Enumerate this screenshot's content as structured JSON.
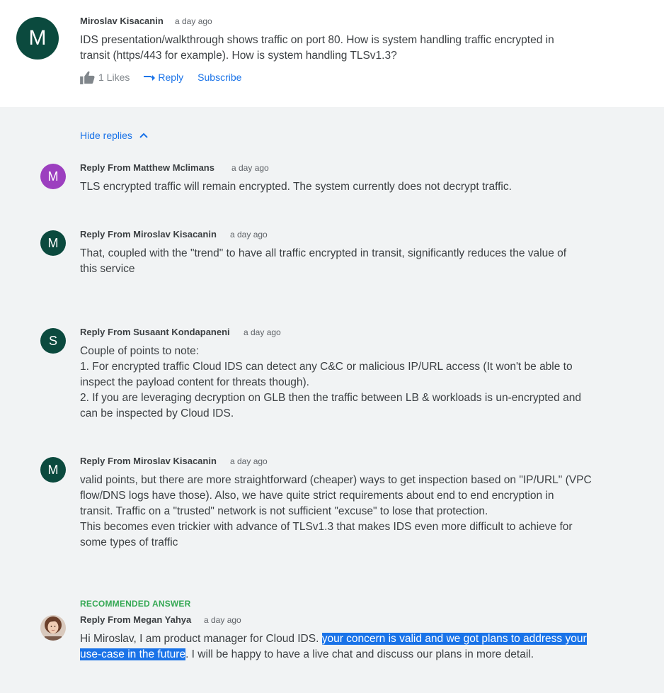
{
  "main_comment": {
    "avatar_letter": "M",
    "avatar_color": "#0b4a3e",
    "author": "Miroslav Kisacanin",
    "timestamp": "a day ago",
    "text_lines": [
      "IDS presentation/walkthrough shows traffic on port 80. How is system handling traffic encrypted in",
      "transit (https/443 for example). How is system handling TLSv1.3?"
    ],
    "likes_label": "1 Likes",
    "reply_label": "Reply",
    "subscribe_label": "Subscribe",
    "icons": [
      "thumbs-up-icon",
      "reply-arrow-icon"
    ]
  },
  "hide_replies_label": "Hide replies",
  "replies": [
    {
      "avatar_letter": "M",
      "avatar_color": "#9c3fbf",
      "author": "Reply From Matthew Mclimans",
      "timestamp": "a day ago",
      "text_lines": [
        "TLS encrypted traffic will remain encrypted.  The system currently does not decrypt traffic."
      ]
    },
    {
      "avatar_letter": "M",
      "avatar_color": "#0b4a3e",
      "author": "Reply From Miroslav Kisacanin",
      "timestamp": "a day ago",
      "text_lines": [
        "That, coupled with the \"trend\" to have all traffic encrypted in transit, significantly reduces the value of",
        "this service"
      ]
    },
    {
      "avatar_letter": "S",
      "avatar_color": "#0b4a3e",
      "author": "Reply From Susaant Kondapaneni",
      "timestamp": "a day ago",
      "text_lines": [
        "Couple of points to note:",
        "1. For encrypted traffic Cloud IDS can detect any C&C or malicious IP/URL access (It won't be able to",
        "inspect the payload content for threats though).",
        "2. If you are leveraging decryption on GLB  then the traffic between LB & workloads is un-encrypted and",
        "can be inspected by Cloud IDS."
      ]
    },
    {
      "avatar_letter": "M",
      "avatar_color": "#0b4a3e",
      "author": "Reply From Miroslav Kisacanin",
      "timestamp": "a day ago",
      "text_lines": [
        "valid points, but there are more straightforward (cheaper) ways to get inspection based on \"IP/URL\" (VPC",
        "flow/DNS logs have those). Also, we have quite strict requirements about end to end encryption in",
        "transit. Traffic on a \"trusted\" network is not sufficient \"excuse\" to lose that protection.",
        "This becomes even trickier with advance of TLSv1.3 that makes IDS even more difficult to achieve for",
        "some types of traffic"
      ]
    }
  ],
  "recommended": {
    "badge": "RECOMMENDED ANSWER",
    "badge_color": "#34a853",
    "author": "Reply From Megan Yahya",
    "timestamp": "a day ago",
    "line1_plain": "Hi Miroslav, I am product manager for Cloud IDS. ",
    "line1_highlight": "your concern is valid and we got plans to address your",
    "line2_highlight": "use-case in the future",
    "line2_plain": ". I will be happy to have a live chat and discuss our plans in more detail.",
    "highlight_color": "#1a73e8"
  }
}
